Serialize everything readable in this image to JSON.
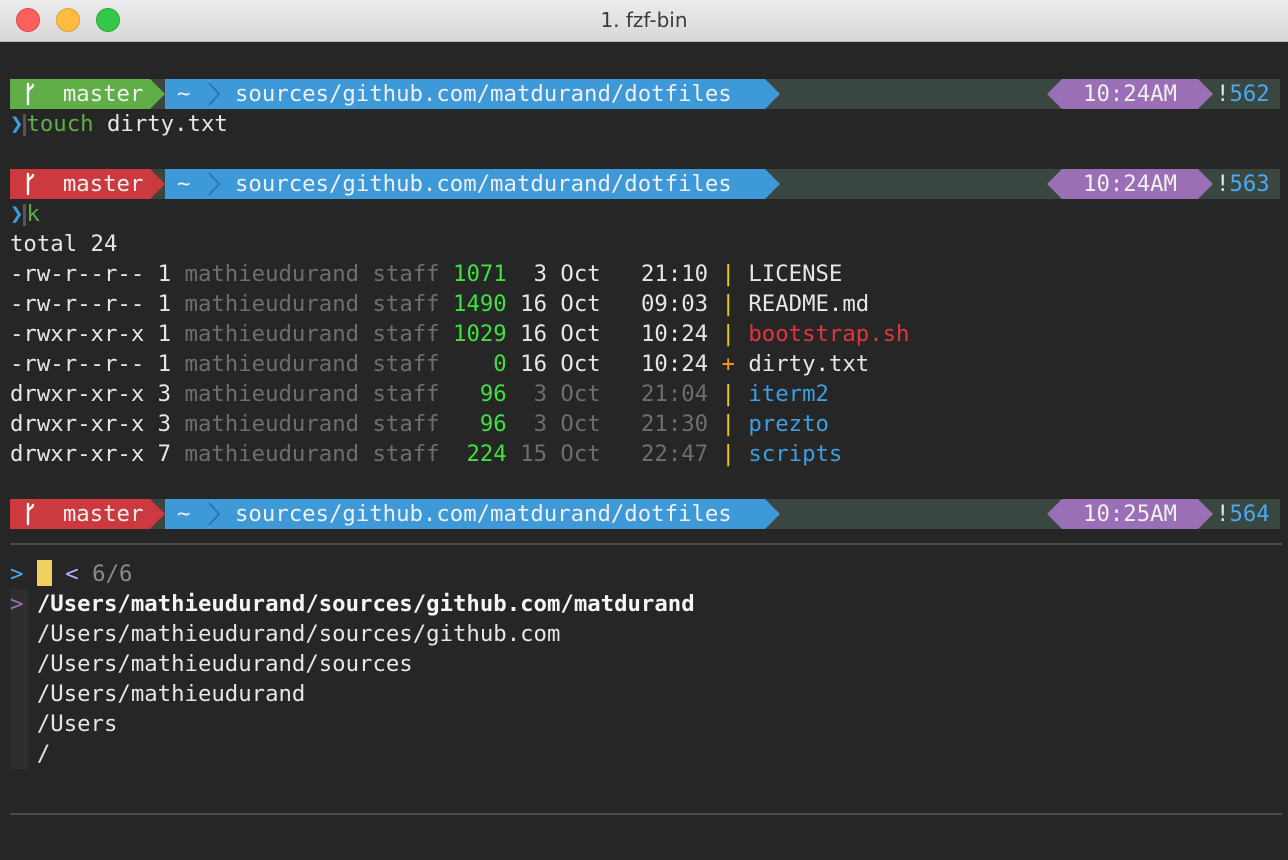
{
  "window": {
    "title": "1. fzf-bin"
  },
  "prompts": [
    {
      "branch": "master",
      "branch_state": "clean",
      "home": "~",
      "path": "sources/github.com/matdurand/dotfiles",
      "time": "10:24AM",
      "hist_bang": "!",
      "hist_num": "562"
    },
    {
      "branch": "master",
      "branch_state": "dirty",
      "home": "~",
      "path": "sources/github.com/matdurand/dotfiles",
      "time": "10:24AM",
      "hist_bang": "!",
      "hist_num": "563"
    },
    {
      "branch": "master",
      "branch_state": "dirty",
      "home": "~",
      "path": "sources/github.com/matdurand/dotfiles",
      "time": "10:25AM",
      "hist_bang": "!",
      "hist_num": "564"
    }
  ],
  "commands": [
    {
      "chevron": "❯",
      "cmd": "touch",
      "args": "dirty.txt"
    },
    {
      "chevron": "❯",
      "cmd": "k",
      "args": ""
    }
  ],
  "listing": {
    "total": "total 24",
    "rows": [
      {
        "perms": "-rw-r--r--",
        "links": "1",
        "owner": "mathieudurand",
        "group": "staff",
        "size": "1071",
        "day": " 3",
        "month": "Oct",
        "time": "21:10",
        "status": "|",
        "name": "LICENSE",
        "kind": "file"
      },
      {
        "perms": "-rw-r--r--",
        "links": "1",
        "owner": "mathieudurand",
        "group": "staff",
        "size": "1490",
        "day": "16",
        "month": "Oct",
        "time": "09:03",
        "status": "|",
        "name": "README.md",
        "kind": "file"
      },
      {
        "perms": "-rwxr-xr-x",
        "links": "1",
        "owner": "mathieudurand",
        "group": "staff",
        "size": "1029",
        "day": "16",
        "month": "Oct",
        "time": "10:24",
        "status": "|",
        "name": "bootstrap.sh",
        "kind": "exec"
      },
      {
        "perms": "-rw-r--r--",
        "links": "1",
        "owner": "mathieudurand",
        "group": "staff",
        "size": "   0",
        "day": "16",
        "month": "Oct",
        "time": "10:24",
        "status": "+",
        "name": "dirty.txt",
        "kind": "file"
      },
      {
        "perms": "drwxr-xr-x",
        "links": "3",
        "owner": "mathieudurand",
        "group": "staff",
        "size": "  96",
        "day": " 3",
        "month": "Oct",
        "time": "21:04",
        "status": "|",
        "name": "iterm2",
        "kind": "dir"
      },
      {
        "perms": "drwxr-xr-x",
        "links": "3",
        "owner": "mathieudurand",
        "group": "staff",
        "size": "  96",
        "day": " 3",
        "month": "Oct",
        "time": "21:30",
        "status": "|",
        "name": "prezto",
        "kind": "dir"
      },
      {
        "perms": "drwxr-xr-x",
        "links": "7",
        "owner": "mathieudurand",
        "group": "staff",
        "size": " 224",
        "day": "15",
        "month": "Oct",
        "time": "22:47",
        "status": "|",
        "name": "scripts",
        "kind": "dir"
      }
    ]
  },
  "fzf": {
    "prompt": ">",
    "query": "",
    "count_prefix": "<",
    "count": "6/6",
    "selected_marker": ">",
    "items": [
      "/Users/mathieudurand/sources/github.com/matdurand",
      "/Users/mathieudurand/sources/github.com",
      "/Users/mathieudurand/sources",
      "/Users/mathieudurand",
      "/Users",
      "/"
    ]
  },
  "colors": {
    "branch_clean": "#5fae47",
    "branch_dirty": "#cc3a3f",
    "path_bg": "#3d99d8",
    "time_bg": "#9b6fb5",
    "statusline_bg": "#3a4740",
    "size_green": "#3ee13e",
    "dir_blue": "#3d9ee0",
    "exec_red": "#e0353c"
  },
  "icons": {
    "branch": "git-branch-icon",
    "chevron": "prompt-chevron-icon"
  }
}
